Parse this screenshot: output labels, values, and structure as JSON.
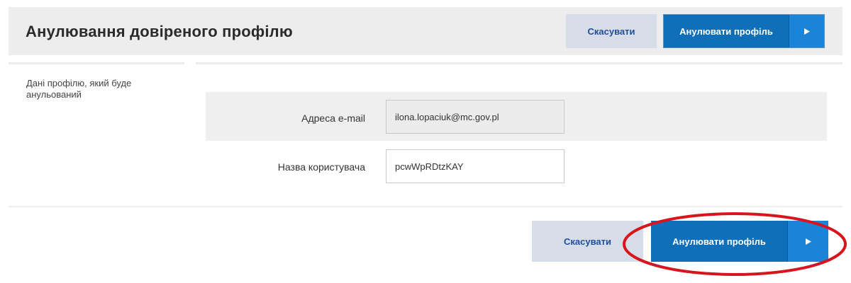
{
  "header": {
    "title": "Анулювання довіреного профілю",
    "cancel_label": "Скасувати",
    "confirm_label": "Анулювати профіль"
  },
  "section": {
    "description": "Дані профілю, який буде анульований"
  },
  "form": {
    "email": {
      "label": "Адреса e-mail",
      "value": "ilona.lopaciuk@mc.gov.pl"
    },
    "username": {
      "label": "Назва користувача",
      "value": "pcwWpRDtzKAY"
    }
  },
  "footer": {
    "cancel_label": "Скасувати",
    "confirm_label": "Анулювати профіль"
  },
  "icons": {
    "confirm_arrow": "play-arrow-icon"
  },
  "colors": {
    "primary": "#0f6fb8",
    "primary_arrow": "#1c84d6",
    "cancel_bg": "#d6dde8",
    "cancel_text": "#1f4e9c",
    "highlight": "#d8141c"
  }
}
